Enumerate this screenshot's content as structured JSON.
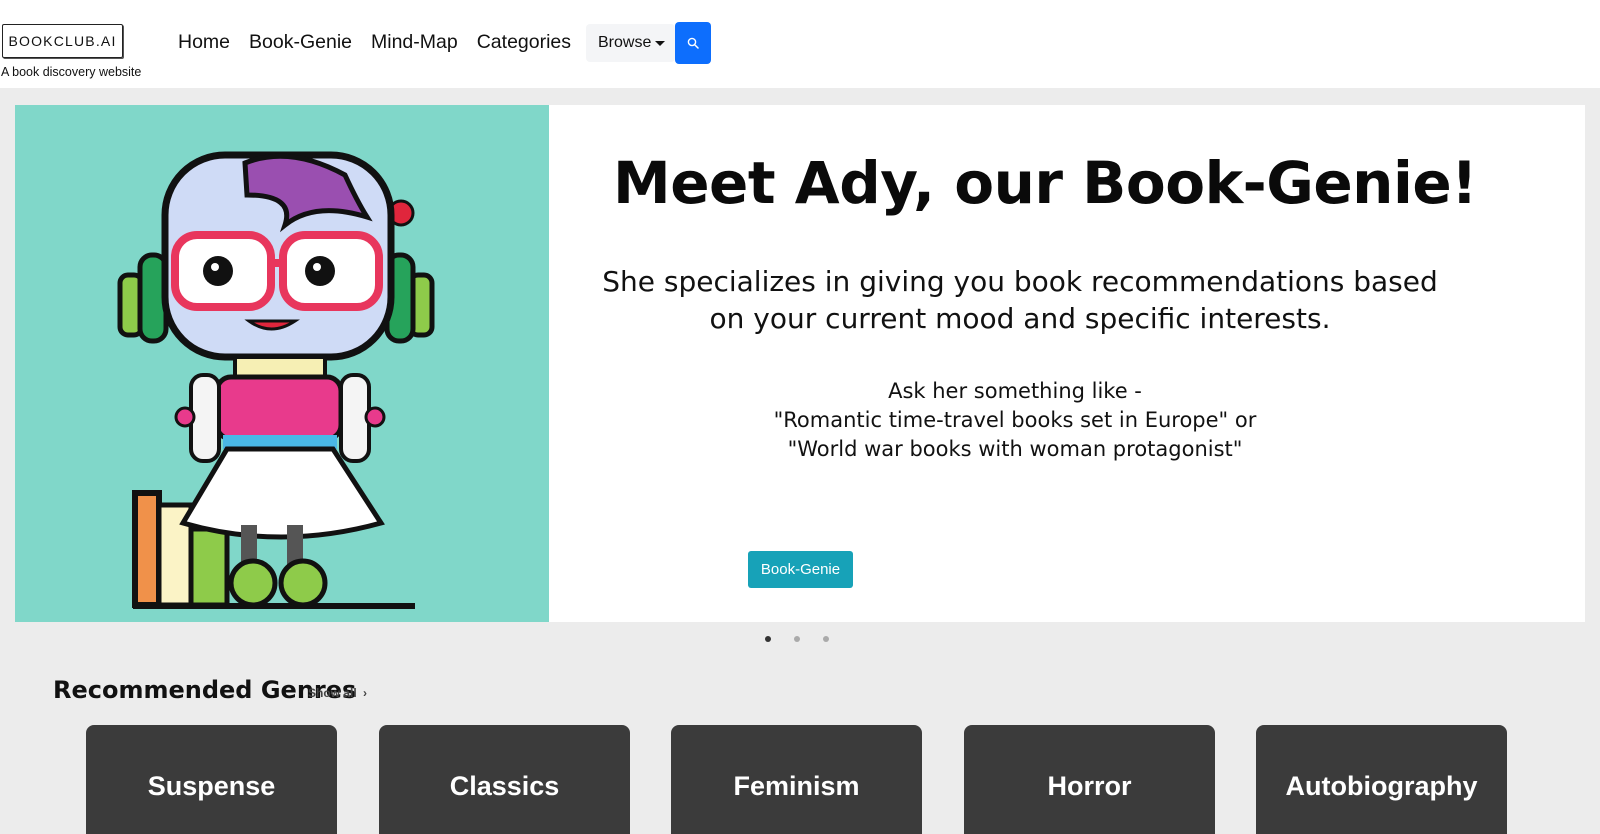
{
  "brand": {
    "logo": "BOOKCLUB.AI",
    "tagline": "A book discovery website"
  },
  "nav": {
    "items": [
      "Home",
      "Book-Genie",
      "Mind-Map",
      "Categories"
    ],
    "browse": "Browse",
    "search_icon": "search-icon"
  },
  "hero": {
    "title": "Meet Ady, our Book-Genie!",
    "description_line1": "She specializes in giving you book recommendations based",
    "description_line2": "on your current mood and specific interests.",
    "ask_line1": "Ask her something like -",
    "ask_line2": "\"Romantic time-travel books set in Europe\" or",
    "ask_line3": "\"World war books with woman protagonist\"",
    "button": "Book-Genie",
    "slides_count": 3,
    "active_slide": 1
  },
  "genres": {
    "title": "Recommended Genres",
    "show_all": "Show all",
    "items": [
      "Suspense",
      "Classics",
      "Feminism",
      "Horror",
      "Autobiography"
    ]
  },
  "colors": {
    "search_button": "#0d6efd",
    "genie_button": "#17a2b8",
    "hero_image_bg": "#80d7c9",
    "genre_card": "#3b3b3b",
    "page_bg": "#ececec"
  }
}
